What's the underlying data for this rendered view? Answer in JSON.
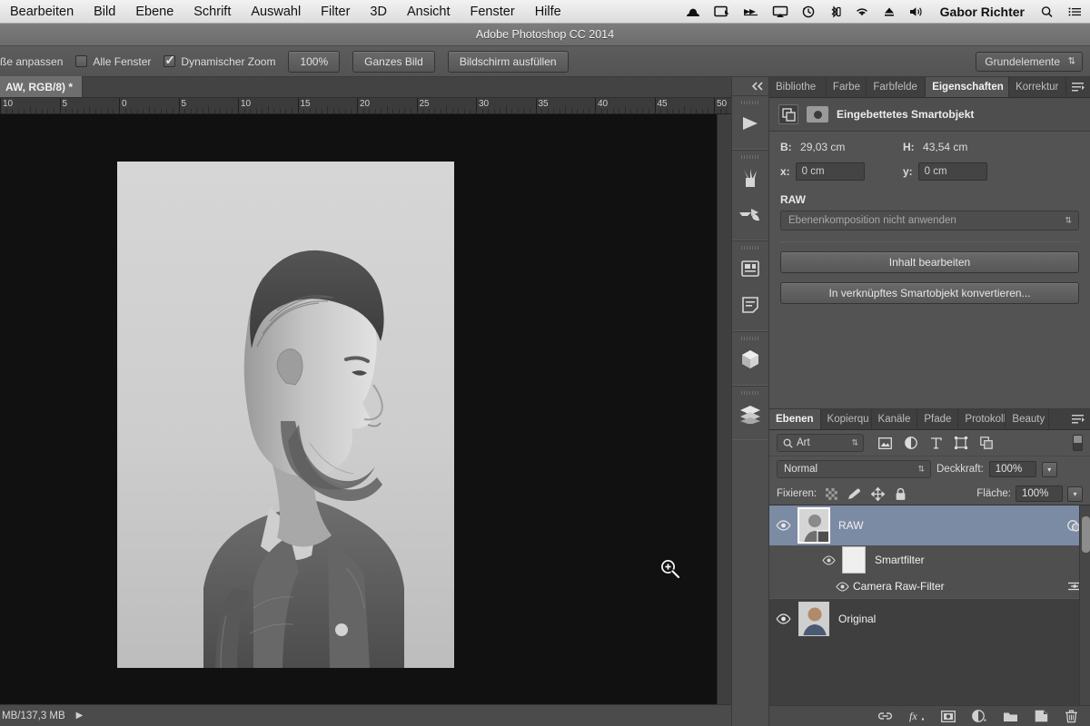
{
  "macbar": {
    "menus": [
      "Bearbeiten",
      "Bild",
      "Ebene",
      "Schrift",
      "Auswahl",
      "Filter",
      "3D",
      "Ansicht",
      "Fenster",
      "Hilfe"
    ],
    "status_icons": [
      "bowler-hat-icon",
      "screen-share-icon",
      "fast-forward-icon",
      "airplay-icon",
      "time-machine-icon",
      "bluetooth-icon",
      "wifi-icon",
      "eject-icon",
      "volume-icon"
    ],
    "user": "Gabor Richter",
    "search_icon": "search-icon",
    "list_icon": "notification-center-icon"
  },
  "titlebar": {
    "title": "Adobe Photoshop CC 2014"
  },
  "options": {
    "resize_label": "ße anpassen",
    "all_windows_label": "Alle Fenster",
    "all_windows_checked": false,
    "dynamic_zoom_label": "Dynamischer Zoom",
    "dynamic_zoom_checked": true,
    "zoom_100_label": "100%",
    "fit_image_label": "Ganzes Bild",
    "fill_screen_label": "Bildschirm ausfüllen",
    "workspace_label": "Grundelemente"
  },
  "document": {
    "tab_label": "AW, RGB/8) *",
    "ruler_ticks": [
      "10",
      "5",
      "0",
      "5",
      "10",
      "15",
      "20",
      "25",
      "30",
      "35",
      "40",
      "45",
      "50"
    ]
  },
  "status": {
    "memory": "MB/137,3 MB",
    "expand_icon": "play-arrow-icon"
  },
  "dock": {
    "collapse_icon": "double-chevron-left-icon",
    "items": [
      "play-icon",
      "brushes-icon",
      "brush-presets-icon",
      "panel-icon",
      "notes-icon",
      "cube-3d-icon",
      "layers-stack-icon"
    ]
  },
  "properties": {
    "tabs": [
      {
        "label": "Bibliothe",
        "active": false
      },
      {
        "label": "Farbe",
        "active": false
      },
      {
        "label": "Farbfelde",
        "active": false
      },
      {
        "label": "Eigenschaften",
        "active": true
      },
      {
        "label": "Korrektur",
        "active": false
      }
    ],
    "menu_icon": "panel-menu-icon",
    "header_title": "Eingebettetes Smartobjekt",
    "smartobject_icon": "smart-object-icon",
    "mask_icon": "mask-icon",
    "width_label": "B:",
    "width_value": "29,03 cm",
    "height_label": "H:",
    "height_value": "43,54 cm",
    "x_label": "x:",
    "x_value": "0 cm",
    "y_label": "y:",
    "y_value": "0 cm",
    "section_title": "RAW",
    "comp_select": "Ebenenkomposition nicht anwenden",
    "edit_content_button": "Inhalt bearbeiten",
    "convert_button": "In verknüpftes Smartobjekt konvertieren..."
  },
  "layers": {
    "tabs": [
      {
        "label": "Ebenen",
        "active": true
      },
      {
        "label": "Kopierqu",
        "active": false
      },
      {
        "label": "Kanäle",
        "active": false
      },
      {
        "label": "Pfade",
        "active": false
      },
      {
        "label": "Protokoll",
        "active": false
      },
      {
        "label": "Beauty R",
        "active": false
      }
    ],
    "menu_icon": "panel-menu-icon",
    "filter_label": "Art",
    "filter_icon": "search-icon",
    "filter_icons": [
      "pixel-layer-filter-icon",
      "adjustment-layer-filter-icon",
      "type-layer-filter-icon",
      "shape-layer-filter-icon",
      "smart-object-filter-icon"
    ],
    "filter_toggle_icon": "filter-toggle-icon",
    "blend_mode": "Normal",
    "opacity_label": "Deckkraft:",
    "opacity_value": "100%",
    "lock_label": "Fixieren:",
    "lock_icons": [
      "lock-transparency-icon",
      "lock-image-icon",
      "lock-position-icon",
      "lock-all-icon"
    ],
    "fill_label": "Fläche:",
    "fill_value": "100%",
    "rows": [
      {
        "name": "RAW",
        "type": "smart-object",
        "selected": true,
        "visible": true,
        "right_icon": "smart-filter-icon"
      },
      {
        "name": "Smartfilter",
        "type": "smart-filter-mask",
        "selected": false,
        "visible": true,
        "right_icon": ""
      },
      {
        "name": "Camera Raw-Filter",
        "type": "smart-filter",
        "selected": false,
        "visible": true,
        "right_icon": "filter-options-icon"
      },
      {
        "name": "Original",
        "type": "pixel",
        "selected": false,
        "visible": true,
        "right_icon": ""
      }
    ],
    "footer_icons": [
      "link-layers-icon",
      "layer-style-fx-icon",
      "add-mask-icon",
      "adjustment-layer-icon",
      "new-group-icon",
      "new-layer-icon",
      "delete-layer-icon"
    ]
  },
  "canvas": {
    "cursor_icon": "zoom-in-cursor-icon",
    "background": "#111111"
  }
}
